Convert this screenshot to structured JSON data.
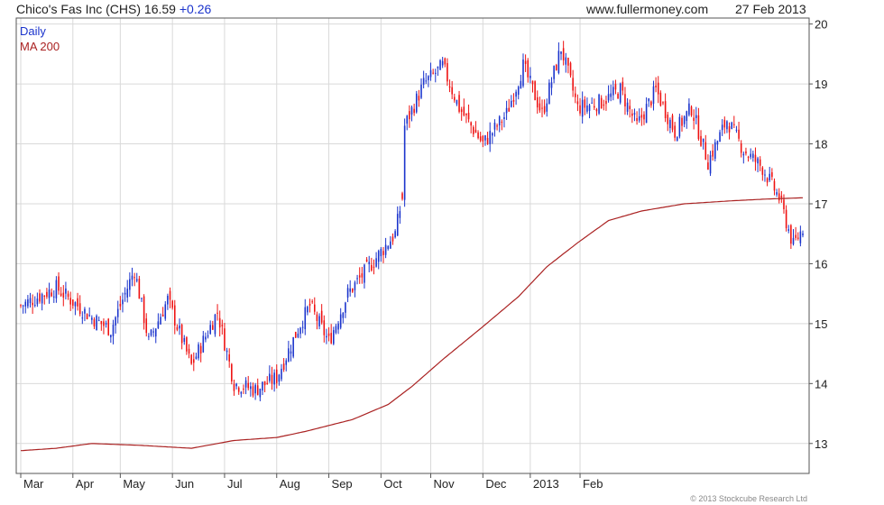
{
  "header": {
    "ticker": "Chico's Fas Inc (CHS) 16.59",
    "change": "+0.26",
    "site": "www.fullermoney.com",
    "date": "27 Feb 2013"
  },
  "legend": {
    "daily": "Daily",
    "ma": "MA 200"
  },
  "copyright": "© 2013 Stockcube Research Ltd",
  "colors": {
    "up": "#1a33cc",
    "down": "#ee1111",
    "ma": "#aa2222",
    "grid": "#d9d9d9",
    "frame": "#555555"
  },
  "chart_data": {
    "type": "candlestick",
    "x_tick_labels": [
      "Mar",
      "Apr",
      "May",
      "Jun",
      "Jul",
      "Aug",
      "Sep",
      "Oct",
      "Nov",
      "Dec",
      "2013",
      "Feb"
    ],
    "y_ticks": [
      13,
      14,
      15,
      16,
      17,
      18,
      19,
      20
    ],
    "ylim": [
      12.5,
      20.1
    ],
    "grid": true,
    "series": [
      {
        "name": "Daily",
        "kind": "ohlc",
        "anchors": [
          [
            0,
            15.3
          ],
          [
            15,
            15.6
          ],
          [
            30,
            15.1
          ],
          [
            38,
            14.9
          ],
          [
            48,
            15.9
          ],
          [
            54,
            14.7
          ],
          [
            62,
            15.4
          ],
          [
            72,
            14.3
          ],
          [
            83,
            15.2
          ],
          [
            90,
            14.0
          ],
          [
            99,
            13.9
          ],
          [
            108,
            14.1
          ],
          [
            118,
            15.0
          ],
          [
            122,
            15.3
          ],
          [
            130,
            14.7
          ],
          [
            138,
            15.5
          ],
          [
            148,
            16.0
          ],
          [
            158,
            16.5
          ],
          [
            161,
            17.1
          ],
          [
            162,
            18.3
          ],
          [
            170,
            19.0
          ],
          [
            178,
            19.3
          ],
          [
            185,
            18.6
          ],
          [
            195,
            18.0
          ],
          [
            205,
            18.5
          ],
          [
            212,
            19.3
          ],
          [
            220,
            18.5
          ],
          [
            228,
            19.6
          ],
          [
            235,
            18.6
          ],
          [
            245,
            18.7
          ],
          [
            253,
            18.9
          ],
          [
            260,
            18.3
          ],
          [
            268,
            18.9
          ],
          [
            276,
            18.2
          ],
          [
            283,
            18.6
          ],
          [
            290,
            17.7
          ],
          [
            298,
            18.4
          ],
          [
            305,
            17.9
          ],
          [
            313,
            17.6
          ],
          [
            320,
            17.1
          ],
          [
            326,
            16.3
          ],
          [
            330,
            16.6
          ]
        ]
      },
      {
        "name": "MA 200",
        "kind": "line",
        "anchors": [
          [
            0,
            12.88
          ],
          [
            15,
            12.92
          ],
          [
            30,
            13.0
          ],
          [
            50,
            12.97
          ],
          [
            72,
            12.92
          ],
          [
            90,
            13.05
          ],
          [
            108,
            13.1
          ],
          [
            120,
            13.2
          ],
          [
            140,
            13.4
          ],
          [
            155,
            13.65
          ],
          [
            165,
            13.95
          ],
          [
            178,
            14.4
          ],
          [
            195,
            14.95
          ],
          [
            210,
            15.45
          ],
          [
            222,
            15.95
          ],
          [
            235,
            16.35
          ],
          [
            248,
            16.72
          ],
          [
            262,
            16.88
          ],
          [
            280,
            17.0
          ],
          [
            300,
            17.05
          ],
          [
            315,
            17.08
          ],
          [
            330,
            17.1
          ]
        ]
      }
    ]
  }
}
